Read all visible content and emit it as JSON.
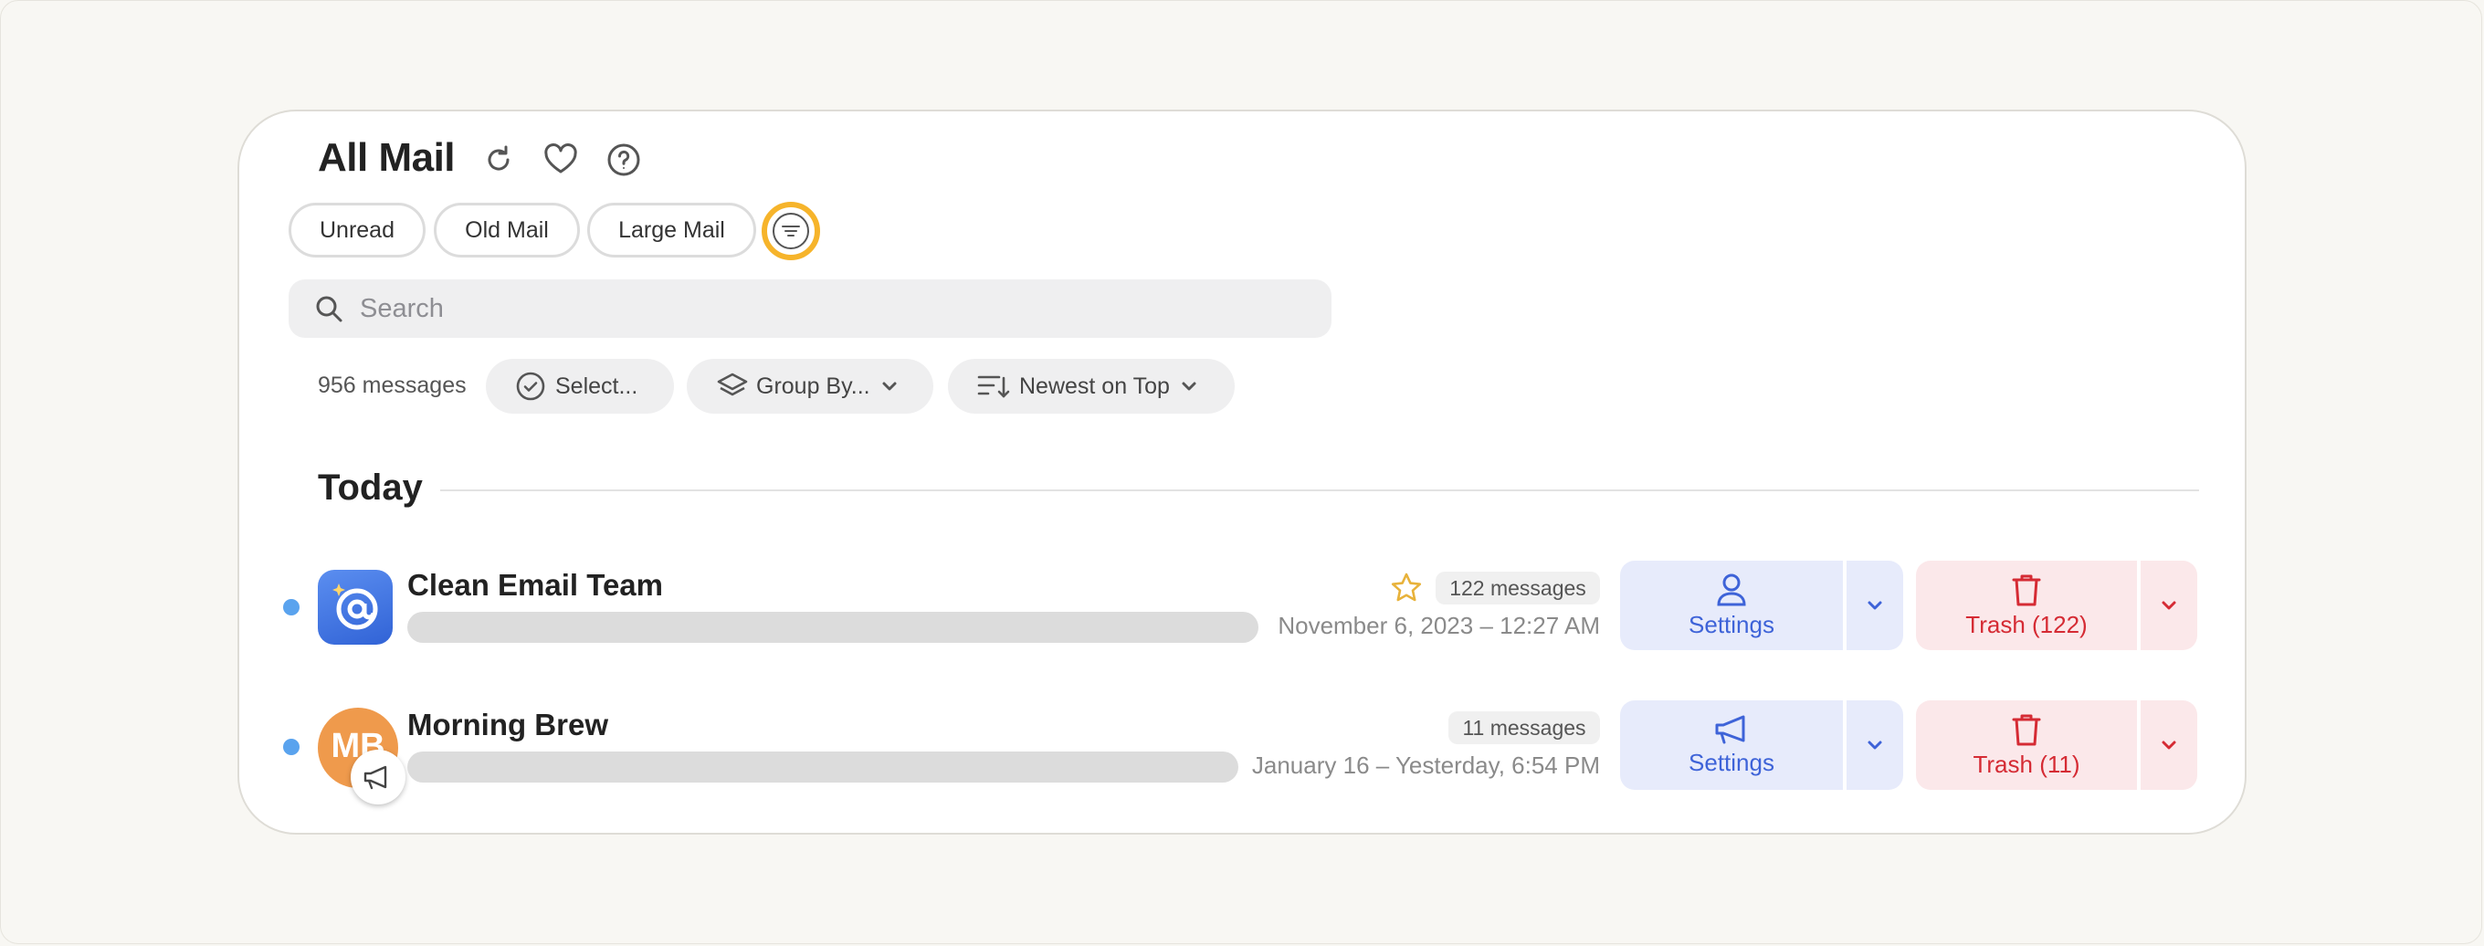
{
  "header": {
    "title": "All Mail",
    "icons": [
      "refresh-icon",
      "heart-icon",
      "help-icon"
    ]
  },
  "quick_filters": [
    "Unread",
    "Old Mail",
    "Large Mail"
  ],
  "filter_button": {
    "icon": "filter-icon",
    "accent": "#f6b42b"
  },
  "search": {
    "placeholder": "Search",
    "value": ""
  },
  "toolbar": {
    "count": "956 messages",
    "select_label": "Select...",
    "group_by_label": "Group By...",
    "sort_label": "Newest on Top"
  },
  "section": {
    "title": "Today"
  },
  "rows": [
    {
      "sender": "Clean Email Team",
      "avatar": "clean-email-logo",
      "starred": true,
      "count": "122 messages",
      "date": "November 6, 2023 – 12:27 AM",
      "primary_action": {
        "label": "Settings",
        "icon": "person-icon"
      },
      "trash_label": "Trash (122)"
    },
    {
      "sender": "Morning Brew",
      "avatar_initials": "MB",
      "avatar_badge": "megaphone-icon",
      "starred": false,
      "count": "11 messages",
      "date": "January 16 – Yesterday, 6:54 PM",
      "primary_action": {
        "label": "Settings",
        "icon": "megaphone-icon"
      },
      "trash_label": "Trash (11)"
    }
  ],
  "colors": {
    "accent_blue": "#3e63d8",
    "accent_red": "#d52b34",
    "unread_dot": "#5aa3ee",
    "star": "#e8b23a"
  }
}
